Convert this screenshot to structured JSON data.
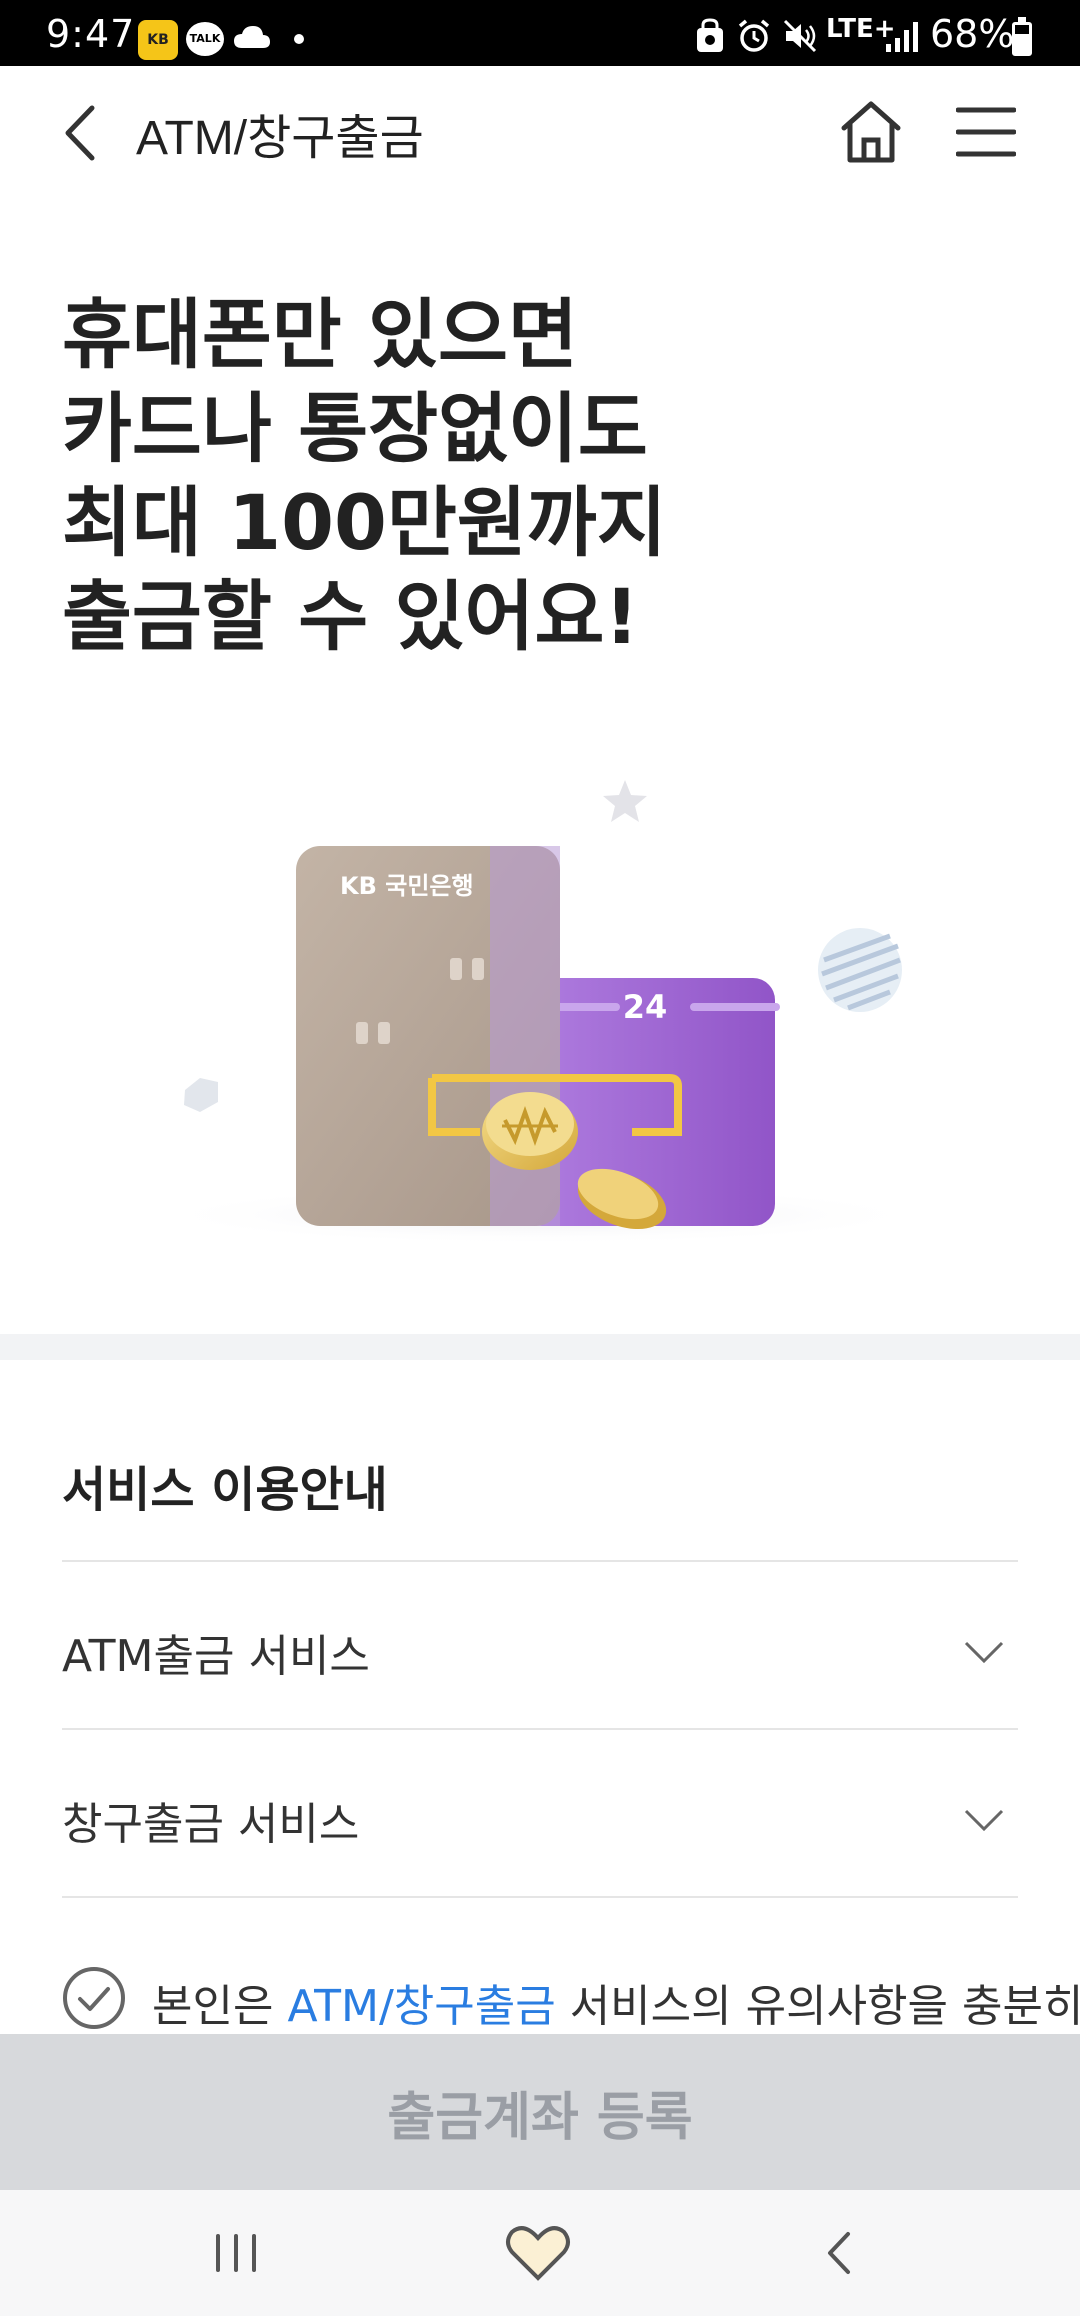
{
  "status_bar": {
    "time": "9:47",
    "kb_badge": "KB",
    "talk_badge": "TALK",
    "network": "LTE+",
    "battery_percent": "68%",
    "battery_level": 0.68
  },
  "header": {
    "title": "ATM/창구출금"
  },
  "hero": {
    "lines": [
      "휴대폰만 있으면",
      "카드나 통장없이도",
      "최대 100만원까지",
      "출금할 수 있어요!"
    ]
  },
  "illustration": {
    "card_brand": "KB 국민은행",
    "calendar_day": "24"
  },
  "guide": {
    "heading": "서비스 이용안내",
    "items": [
      {
        "label": "ATM출금 서비스"
      },
      {
        "label": "창구출금 서비스"
      }
    ]
  },
  "agreement": {
    "prefix": "본인은 ",
    "highlight": "ATM/창구출금",
    "suffix": " 서비스의 유의사항을 충분히"
  },
  "cta": {
    "label": "출금계좌 등록"
  },
  "colors": {
    "accent": "#2a7de1",
    "card_beige": "#b6a595",
    "calendar_purple": "#9b5fd0",
    "coin_gold": "#e6c15a",
    "cta_disabled_bg": "#d7d9dc"
  }
}
